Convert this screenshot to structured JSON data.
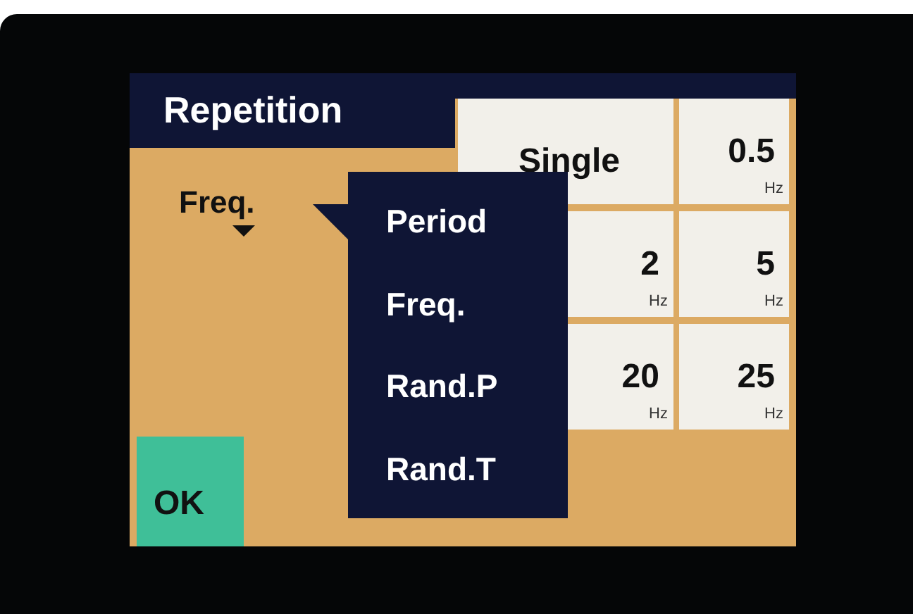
{
  "title": "Repetition",
  "mode": {
    "value": "Freq.",
    "expanded": true
  },
  "menu": [
    {
      "label": "Period"
    },
    {
      "label": "Freq."
    },
    {
      "label": "Rand.P"
    },
    {
      "label": "Rand.T"
    }
  ],
  "options": [
    {
      "value": "Single"
    },
    {
      "value": "0.5",
      "unit": "Hz"
    },
    {
      "value": "2",
      "unit": "Hz"
    },
    {
      "value": "5",
      "unit": "Hz"
    },
    {
      "value": "20",
      "unit": "Hz"
    },
    {
      "value": "25",
      "unit": "Hz"
    }
  ],
  "ok": "OK"
}
